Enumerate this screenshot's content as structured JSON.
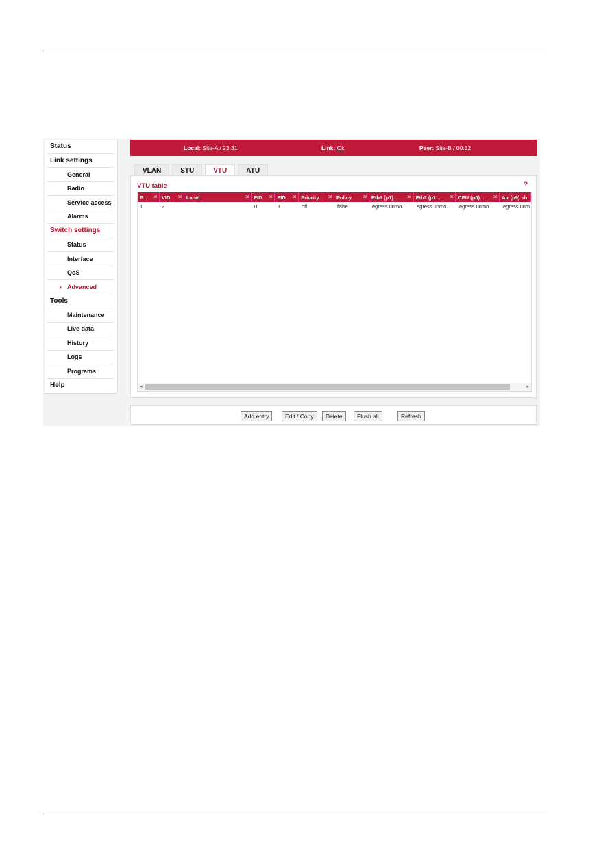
{
  "sidebar": {
    "items": [
      {
        "label": "Status",
        "level": "top"
      },
      {
        "label": "Link settings",
        "level": "top"
      },
      {
        "label": "General",
        "level": "sub"
      },
      {
        "label": "Radio",
        "level": "sub"
      },
      {
        "label": "Service access",
        "level": "sub"
      },
      {
        "label": "Alarms",
        "level": "sub"
      },
      {
        "label": "Switch settings",
        "level": "top",
        "active": true
      },
      {
        "label": "Status",
        "level": "sub"
      },
      {
        "label": "Interface",
        "level": "sub"
      },
      {
        "label": "QoS",
        "level": "sub"
      },
      {
        "label": "Advanced",
        "level": "sub",
        "active": true
      },
      {
        "label": "Tools",
        "level": "top"
      },
      {
        "label": "Maintenance",
        "level": "sub"
      },
      {
        "label": "Live data",
        "level": "sub"
      },
      {
        "label": "History",
        "level": "sub"
      },
      {
        "label": "Logs",
        "level": "sub"
      },
      {
        "label": "Programs",
        "level": "sub"
      },
      {
        "label": "Help",
        "level": "top"
      }
    ]
  },
  "header": {
    "local_label": "Local:",
    "local_value": "Site-A / 23:31",
    "link_label": "Link:",
    "link_value": "Ok",
    "peer_label": "Peer:",
    "peer_value": "Site-B / 00:32"
  },
  "tabs": [
    {
      "label": "VLAN"
    },
    {
      "label": "STU"
    },
    {
      "label": "VTU",
      "active": true
    },
    {
      "label": "ATU"
    }
  ],
  "panel": {
    "title": "VTU table",
    "help": "?"
  },
  "table": {
    "columns": [
      "P...",
      "VID",
      "Label",
      "FID",
      "SID",
      "Priority",
      "Policy",
      "Eth1 (p1)...",
      "Eth2 (p1...",
      "CPU (p0)...",
      "Air (p9) sh"
    ],
    "rows": [
      [
        "1",
        "2",
        "",
        "0",
        "1",
        "off",
        "false",
        "egress unmo...",
        "egress unmo...",
        "egress unmo...",
        "egress unm"
      ]
    ]
  },
  "buttons": {
    "add": "Add entry",
    "edit": "Edit / Copy",
    "delete": "Delete",
    "flush": "Flush all",
    "refresh": "Refresh"
  },
  "colors": {
    "accent": "#c01a3a"
  }
}
